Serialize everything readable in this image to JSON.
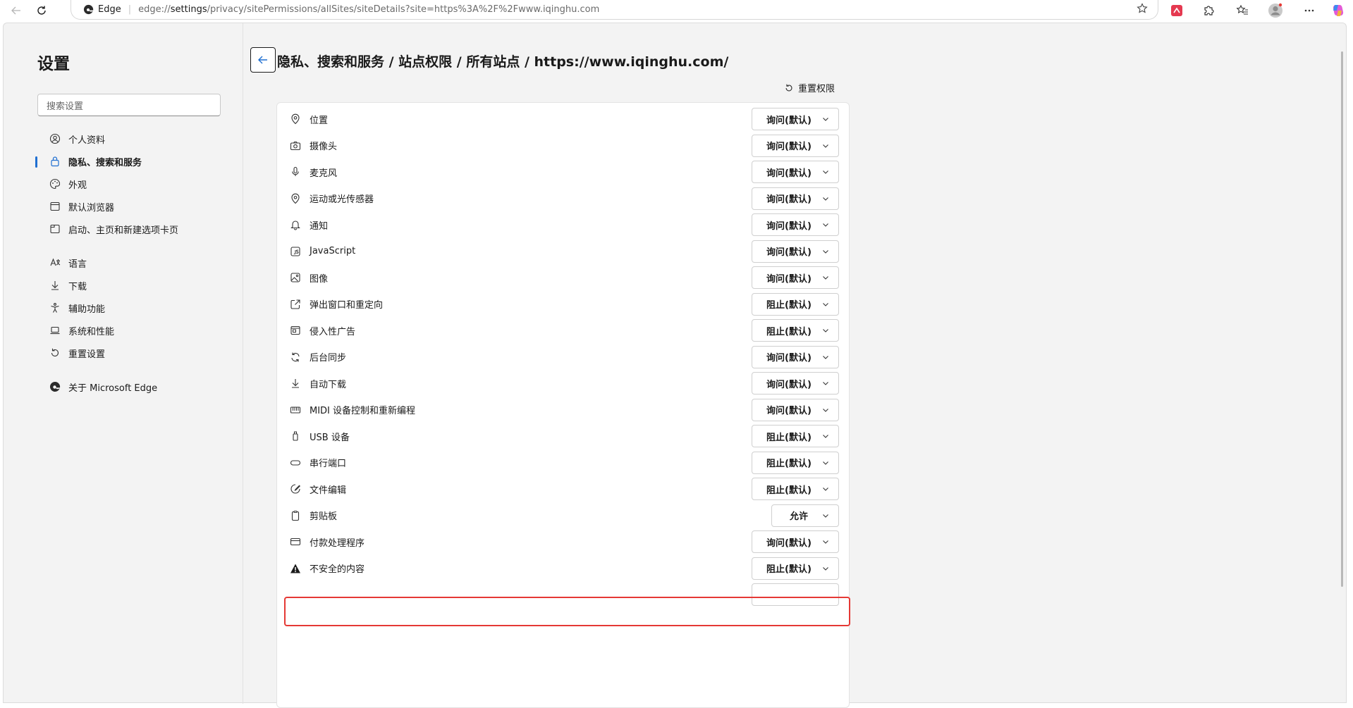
{
  "browser": {
    "brand": "Edge",
    "url_prefix": "edge://",
    "url_bold": "settings",
    "url_rest": "/privacy/sitePermissions/allSites/siteDetails?site=https%3A%2F%2Fwww.iqinghu.com"
  },
  "sidebar": {
    "title": "设置",
    "search_placeholder": "搜索设置",
    "items": [
      {
        "label": "个人资料",
        "icon": "profile-icon"
      },
      {
        "label": "隐私、搜索和服务",
        "icon": "privacy-lock-icon",
        "active": true
      },
      {
        "label": "外观",
        "icon": "appearance-icon"
      },
      {
        "label": "默认浏览器",
        "icon": "browser-window-icon"
      },
      {
        "label": "启动、主页和新建选项卡页",
        "icon": "home-tab-icon"
      },
      {
        "label": "语言",
        "icon": "language-icon"
      },
      {
        "label": "下载",
        "icon": "download-icon"
      },
      {
        "label": "辅助功能",
        "icon": "accessibility-icon"
      },
      {
        "label": "系统和性能",
        "icon": "laptop-icon"
      },
      {
        "label": "重置设置",
        "icon": "reset-icon"
      },
      {
        "label": "关于 Microsoft Edge",
        "icon": "edge-logo-icon"
      }
    ]
  },
  "content": {
    "breadcrumb": "隐私、搜索和服务 / 站点权限 / 所有站点 / https://www.iqinghu.com/",
    "reset_permissions": "重置权限",
    "permissions": [
      {
        "label": "位置",
        "value": "询问(默认)",
        "icon": "location-icon"
      },
      {
        "label": "摄像头",
        "value": "询问(默认)",
        "icon": "camera-icon"
      },
      {
        "label": "麦克风",
        "value": "询问(默认)",
        "icon": "microphone-icon"
      },
      {
        "label": "运动或光传感器",
        "value": "询问(默认)",
        "icon": "sensor-icon"
      },
      {
        "label": "通知",
        "value": "询问(默认)",
        "icon": "bell-icon"
      },
      {
        "label": "JavaScript",
        "value": "询问(默认)",
        "icon": "javascript-icon"
      },
      {
        "label": "图像",
        "value": "询问(默认)",
        "icon": "image-icon"
      },
      {
        "label": "弹出窗口和重定向",
        "value": "阻止(默认)",
        "icon": "popup-icon"
      },
      {
        "label": "侵入性广告",
        "value": "阻止(默认)",
        "icon": "ads-icon"
      },
      {
        "label": "后台同步",
        "value": "询问(默认)",
        "icon": "sync-icon"
      },
      {
        "label": "自动下载",
        "value": "询问(默认)",
        "icon": "download-icon"
      },
      {
        "label": "MIDI 设备控制和重新编程",
        "value": "询问(默认)",
        "icon": "midi-icon"
      },
      {
        "label": "USB 设备",
        "value": "阻止(默认)",
        "icon": "usb-icon"
      },
      {
        "label": "串行端口",
        "value": "阻止(默认)",
        "icon": "serial-port-icon"
      },
      {
        "label": "文件编辑",
        "value": "阻止(默认)",
        "icon": "file-edit-icon"
      },
      {
        "label": "剪贴板",
        "value": "允许",
        "icon": "clipboard-icon",
        "highlighted": true
      },
      {
        "label": "付款处理程序",
        "value": "询问(默认)",
        "icon": "payment-card-icon"
      },
      {
        "label": "不安全的内容",
        "value": "阻止(默认)",
        "icon": "warning-icon"
      }
    ]
  },
  "colors": {
    "accent": "#1f6fd1",
    "highlight_border": "#e53935",
    "page_background": "#f3f3f3"
  }
}
